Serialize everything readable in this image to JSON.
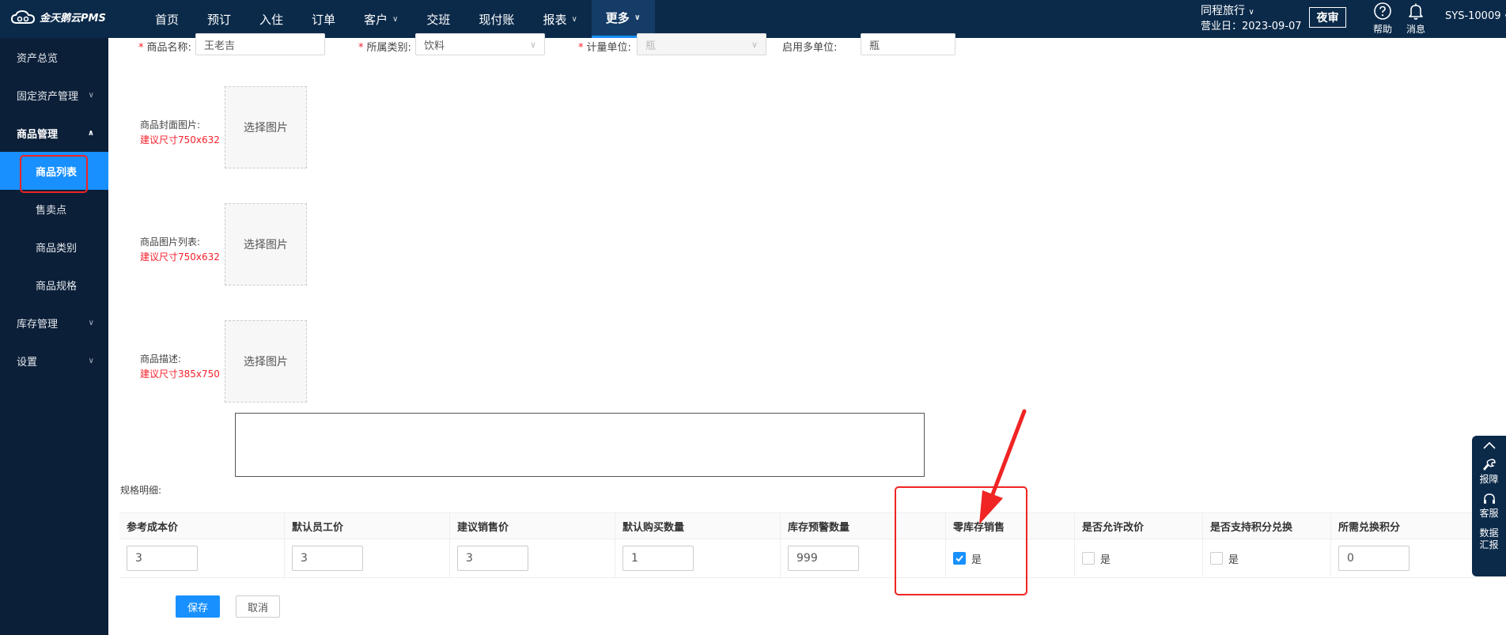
{
  "brand": {
    "name": "金天鹅云PMS"
  },
  "nav": {
    "items": [
      {
        "label": "首页",
        "dropdown": false
      },
      {
        "label": "预订",
        "dropdown": false
      },
      {
        "label": "入住",
        "dropdown": false
      },
      {
        "label": "订单",
        "dropdown": false
      },
      {
        "label": "客户",
        "dropdown": true
      },
      {
        "label": "交班",
        "dropdown": false
      },
      {
        "label": "现付账",
        "dropdown": false
      },
      {
        "label": "报表",
        "dropdown": true
      },
      {
        "label": "更多",
        "dropdown": true,
        "active": true
      }
    ],
    "hotel": "同程旅行",
    "business_day": "营业日：2023-09-07",
    "night_audit": "夜审",
    "help": "帮助",
    "messages": "消息",
    "user": "SYS-10009"
  },
  "sidebar": {
    "items": [
      {
        "label": "资产总览"
      },
      {
        "label": "固定资产管理"
      },
      {
        "label": "商品管理"
      },
      {
        "label": "商品列表"
      },
      {
        "label": "售卖点"
      },
      {
        "label": "商品类别"
      },
      {
        "label": "商品规格"
      },
      {
        "label": "库存管理"
      },
      {
        "label": "设置"
      }
    ]
  },
  "form": {
    "name_label": "商品名称:",
    "name_value": "王老吉",
    "category_label": "所属类别:",
    "category_value": "饮料",
    "unit_label": "计量单位:",
    "unit_value": "瓶",
    "multi_unit_label": "启用多单位:",
    "multi_unit_value": "瓶",
    "cover_label": "商品封面图片:",
    "cover_hint": "建议尺寸750x632",
    "gallery_label": "商品图片列表:",
    "gallery_hint": "建议尺寸750x632",
    "desc_label": "商品描述:",
    "desc_hint": "建议尺寸385x750",
    "choose_image": "选择图片",
    "spec_label": "规格明细:"
  },
  "spec_table": {
    "headers": [
      "参考成本价",
      "默认员工价",
      "建议销售价",
      "默认购买数量",
      "库存预警数量",
      "零库存销售",
      "是否允许改价",
      "是否支持积分兑换",
      "所需兑换积分"
    ],
    "row": {
      "cost": "3",
      "staff_price": "3",
      "sale_price": "3",
      "buy_qty": "1",
      "stock_warn": "999",
      "zero_stock_checked": true,
      "zero_stock_label": "是",
      "allow_price_change_checked": false,
      "allow_price_change_label": "是",
      "points_exchange_checked": false,
      "points_exchange_label": "是",
      "points_needed": "0"
    }
  },
  "actions": {
    "save": "保存",
    "cancel": "取消"
  },
  "float_panel": {
    "report": "报障",
    "service": "客服",
    "data_report_1": "数据",
    "data_report_2": "汇报"
  },
  "colors": {
    "topbar": "#0b2a4a",
    "sidebar": "#0b1f38",
    "accent": "#1890ff",
    "annotation": "#f02424"
  }
}
